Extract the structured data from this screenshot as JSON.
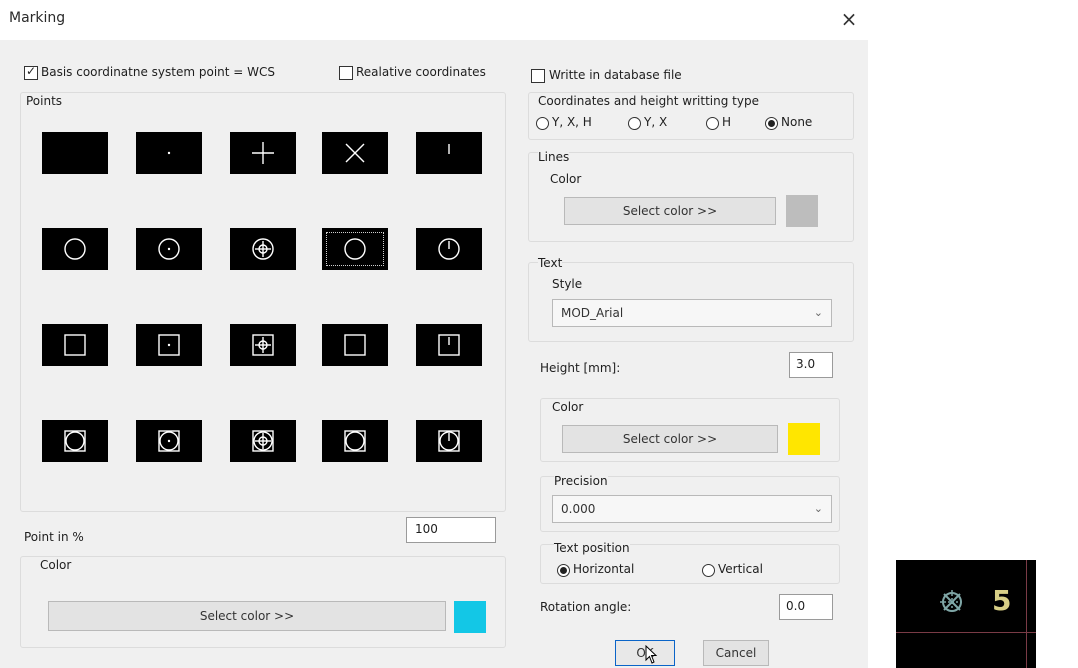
{
  "window": {
    "title": "Marking",
    "close_glyph": "×"
  },
  "left": {
    "basis_checkbox": {
      "label": "Basis coordinatne system point = WCS",
      "checked": true
    },
    "relative_checkbox": {
      "label": "Realative coordinates",
      "checked": false
    },
    "points_label": "Points",
    "point_symbols": [
      [
        "empty",
        "dot",
        "plus",
        "cross",
        "tick"
      ],
      [
        "circle",
        "circle-dot",
        "circle-plus",
        "circle-x",
        "circle-tick"
      ],
      [
        "square",
        "square-dot",
        "square-plus",
        "square-x",
        "square-tick"
      ],
      [
        "square-circle",
        "square-circle-dot",
        "square-circle-plus",
        "square-circle-x",
        "square-circle-tick"
      ]
    ],
    "selected_symbol": "circle-x",
    "point_in_percent_label": "Point in %",
    "point_in_percent_value": "100",
    "color_group_label": "Color",
    "select_color_label": "Select color >>",
    "color_swatch": "#13c7e6"
  },
  "right": {
    "write_db_checkbox": {
      "label": "Writte in database file",
      "checked": false
    },
    "coord_type_label": "Coordinates and height writting type",
    "coord_type_options": [
      "Y, X, H",
      "Y, X",
      "H",
      "None"
    ],
    "coord_type_selected": "None",
    "lines": {
      "label": "Lines",
      "color_label": "Color",
      "select_color_label": "Select color >>",
      "swatch": "#bdbdbd"
    },
    "text": {
      "label": "Text",
      "style_label": "Style",
      "style_value": "MOD_Arial",
      "height_label": "Height [mm]:",
      "height_value": "3.0",
      "color_label": "Color",
      "select_color_label": "Select color >>",
      "swatch": "#ffe600",
      "precision_label": "Precision",
      "precision_value": "0.000",
      "text_position_label": "Text position",
      "position_options": [
        "Horizontal",
        "Vertical"
      ],
      "position_selected": "Horizontal",
      "rotation_label": "Rotation angle:",
      "rotation_value": "0.0"
    },
    "ok_label": "OK",
    "cancel_label": "Cancel"
  },
  "preview": {
    "label_text": "5",
    "marker_color": "#7fa6a6",
    "text_color": "#d8cf86"
  },
  "icons": {
    "chevron": "chevron-down-icon",
    "cursor": "mouse-cursor-icon"
  }
}
